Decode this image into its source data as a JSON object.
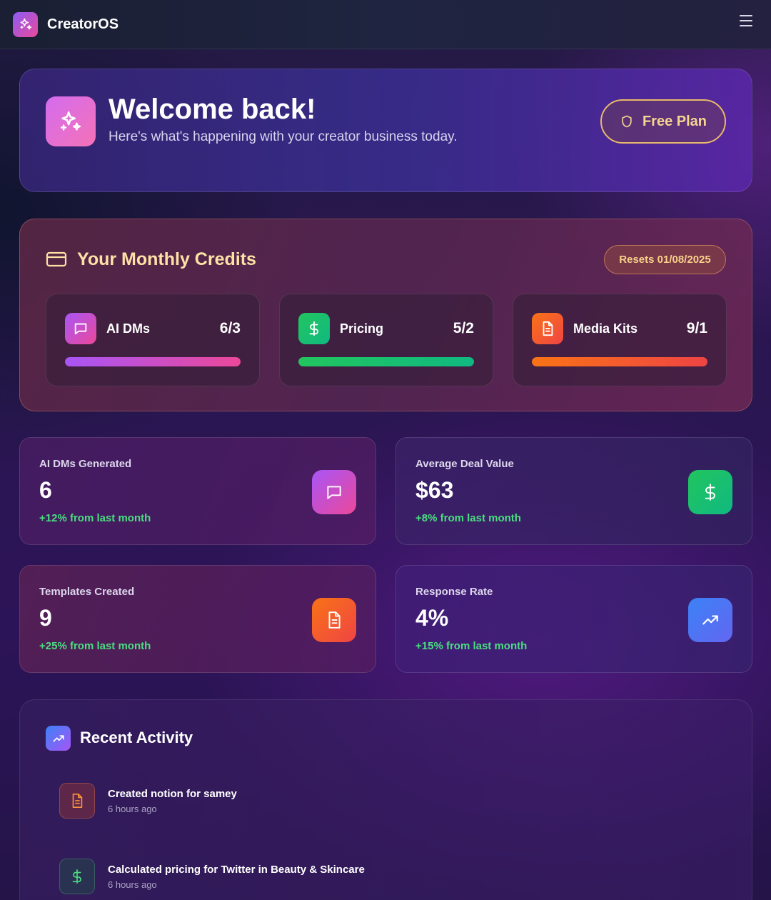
{
  "app": {
    "name": "CreatorOS"
  },
  "welcome": {
    "title": "Welcome back!",
    "subtitle": "Here's what's happening with your creator business today.",
    "plan_label": "Free Plan"
  },
  "credits": {
    "title": "Your Monthly Credits",
    "reset_label": "Resets 01/08/2025",
    "items": [
      {
        "label": "AI DMs",
        "count": "6/3",
        "icon": "message-icon",
        "progress": 1.0,
        "color_from": "#a855f7",
        "color_to": "#ec4899"
      },
      {
        "label": "Pricing",
        "count": "5/2",
        "icon": "dollar-icon",
        "progress": 1.0,
        "color_from": "#22c55e",
        "color_to": "#10b981"
      },
      {
        "label": "Media Kits",
        "count": "9/1",
        "icon": "document-icon",
        "progress": 1.0,
        "color_from": "#f97316",
        "color_to": "#ef4444"
      }
    ]
  },
  "stats": [
    {
      "label": "AI DMs Generated",
      "value": "6",
      "change": "+12% from last month",
      "icon": "message-icon"
    },
    {
      "label": "Average Deal Value",
      "value": "$63",
      "change": "+8% from last month",
      "icon": "dollar-icon"
    },
    {
      "label": "Templates Created",
      "value": "9",
      "change": "+25% from last month",
      "icon": "document-icon"
    },
    {
      "label": "Response Rate",
      "value": "4%",
      "change": "+15% from last month",
      "icon": "trending-up-icon"
    }
  ],
  "activity": {
    "title": "Recent Activity",
    "items": [
      {
        "text": "Created notion for samey",
        "time": "6 hours ago",
        "icon": "document-icon"
      },
      {
        "text": "Calculated pricing for Twitter in Beauty & Skincare",
        "time": "6 hours ago",
        "icon": "dollar-icon"
      }
    ]
  }
}
